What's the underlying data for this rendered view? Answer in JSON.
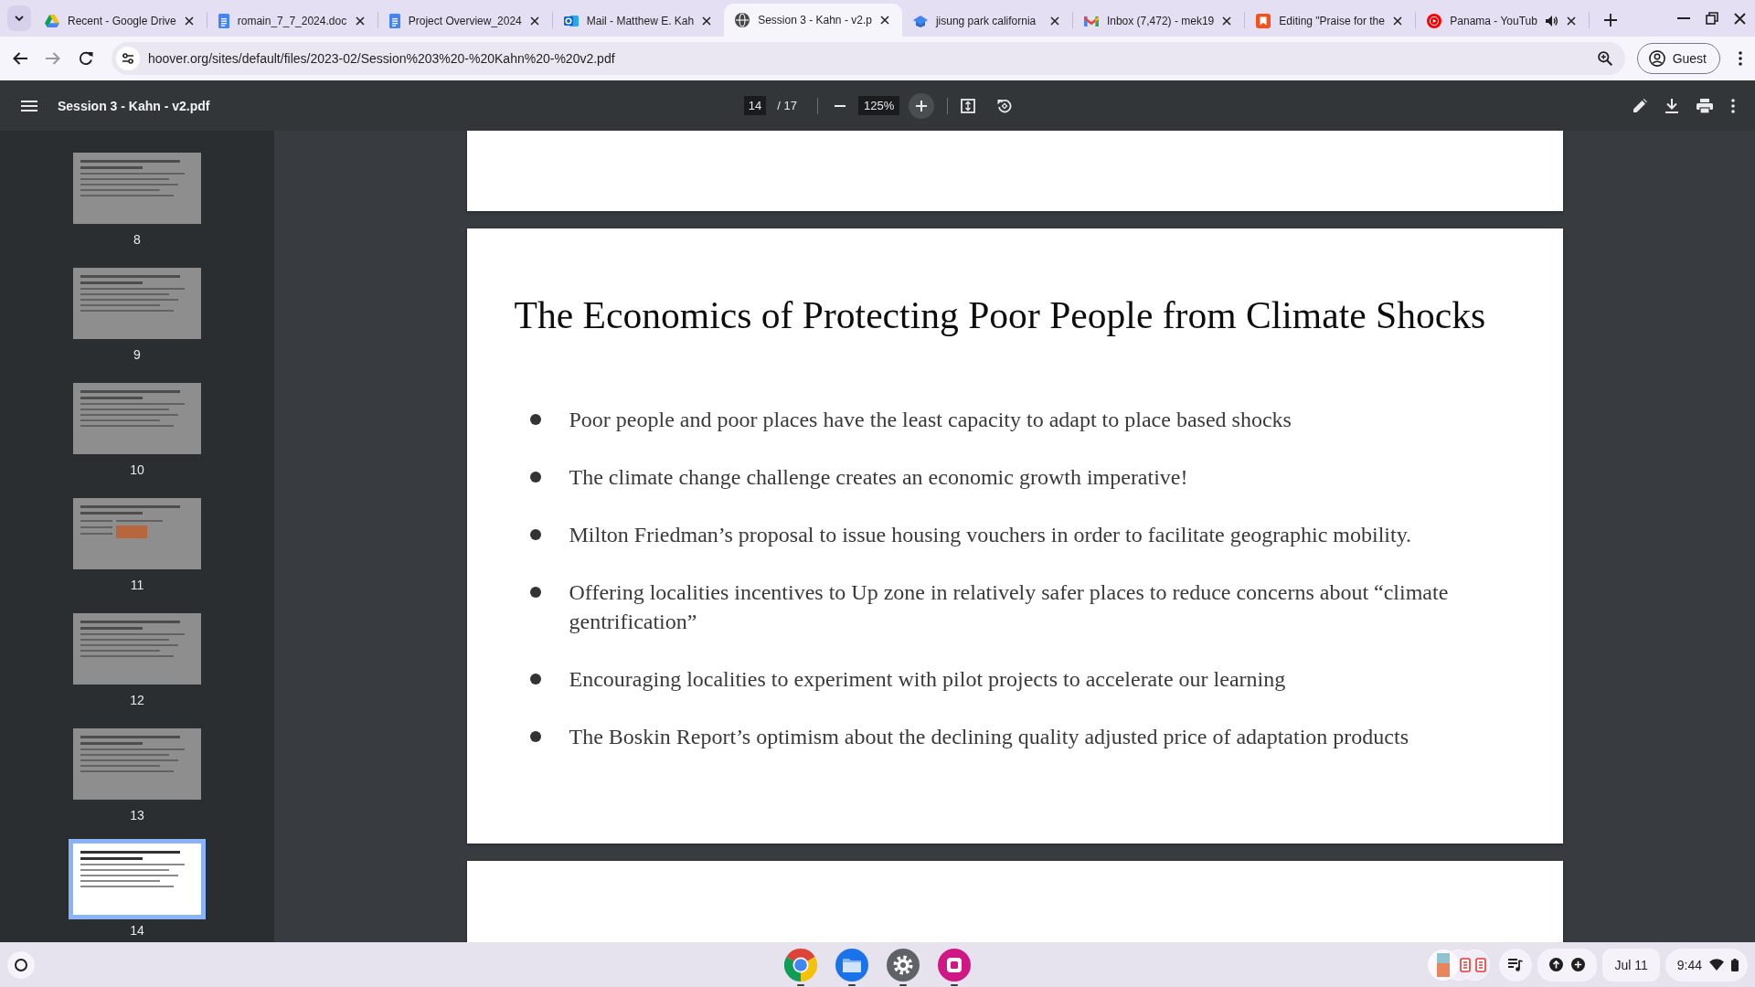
{
  "tabs": [
    {
      "kind": "triangle",
      "title": "Recent - Google Drive",
      "selected": false,
      "audio": false
    },
    {
      "kind": "document",
      "title": "romain_7_7_2024.doc",
      "selected": false,
      "audio": false
    },
    {
      "kind": "document",
      "title": "Project Overview_2024",
      "selected": false,
      "audio": false
    },
    {
      "kind": "ring-tile",
      "title": "Mail - Matthew E. Kah",
      "selected": false,
      "audio": false
    },
    {
      "kind": "globe",
      "title": "Session 3 - Kahn - v2.p",
      "selected": true,
      "audio": false
    },
    {
      "kind": "cap",
      "title": "jisung park california",
      "selected": false,
      "audio": false
    },
    {
      "kind": "envelope",
      "title": "Inbox (7,472) - mek19",
      "selected": false,
      "audio": false
    },
    {
      "kind": "bookmark-tile",
      "title": "Editing \"Praise for the",
      "selected": false,
      "audio": false
    },
    {
      "kind": "play-circle",
      "title": "Panama - YouTub",
      "selected": false,
      "audio": true
    }
  ],
  "navigation": {
    "back_disabled": false,
    "forward_disabled": true
  },
  "address_bar": {
    "url": "hoover.org/sites/default/files/2023-02/Session%203%20-%20Kahn%20-%20v2.pdf"
  },
  "profile": {
    "label": "Guest"
  },
  "pdf_toolbar": {
    "file_name": "Session 3 - Kahn - v2.pdf",
    "page_number": "14",
    "page_total": "/ 17",
    "zoom": "125%"
  },
  "thumbnails": [
    {
      "number": "8",
      "kind": "text",
      "selected": false
    },
    {
      "number": "9",
      "kind": "text",
      "selected": false
    },
    {
      "number": "10",
      "kind": "text",
      "selected": false
    },
    {
      "number": "11",
      "kind": "screenshot",
      "selected": false
    },
    {
      "number": "12",
      "kind": "text",
      "selected": false
    },
    {
      "number": "13",
      "kind": "text",
      "selected": false
    },
    {
      "number": "14",
      "kind": "text",
      "selected": true
    }
  ],
  "page": {
    "title": "The Economics of Protecting Poor People from Climate Shocks",
    "bullets": [
      "Poor people and poor places have the least capacity to adapt to place based shocks",
      "The climate change challenge creates an economic growth imperative!",
      "Milton Friedman’s proposal to issue housing vouchers in order to facilitate geographic mobility.",
      "Offering localities incentives to Up zone in relatively safer places to reduce concerns about “climate gentrification”",
      "Encouraging localities to experiment with pilot projects to accelerate our learning",
      "The Boskin Report’s optimism about the declining quality adjusted price of adaptation products"
    ]
  },
  "shelf": {
    "apps": [
      {
        "kind": "browser",
        "running": true
      },
      {
        "kind": "folder",
        "running": true
      },
      {
        "kind": "gear",
        "running": true
      },
      {
        "kind": "app",
        "running": true
      }
    ],
    "date": "Jul 11",
    "time": "9:44"
  }
}
